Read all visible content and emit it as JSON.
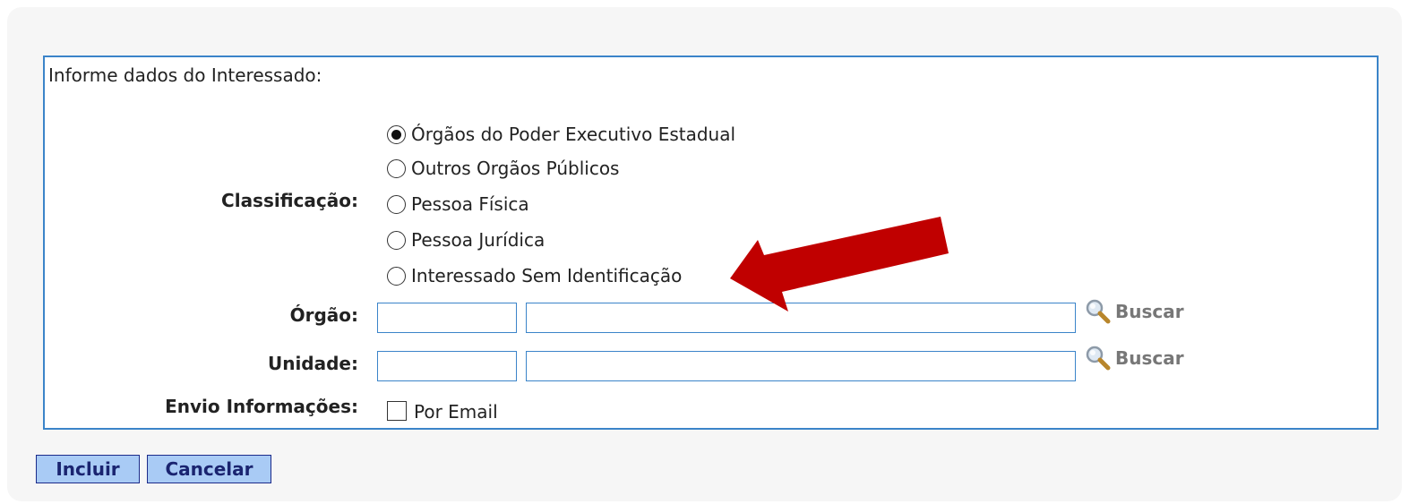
{
  "form": {
    "title": "Informe dados do Interessado:",
    "classificacao_label": "Classificação:",
    "classificacao_options": [
      {
        "label": "Órgãos do Poder Executivo Estadual",
        "checked": true
      },
      {
        "label": "Outros Orgãos Públicos",
        "checked": false
      },
      {
        "label": "Pessoa Física",
        "checked": false
      },
      {
        "label": "Pessoa Jurídica",
        "checked": false
      },
      {
        "label": "Interessado Sem Identificação",
        "checked": false
      }
    ],
    "orgao_label": "Órgão:",
    "orgao_code_value": "",
    "orgao_name_value": "",
    "unidade_label": "Unidade:",
    "unidade_code_value": "",
    "unidade_name_value": "",
    "buscar_label": "Buscar",
    "envio_label": "Envio Informações:",
    "por_email_label": "Por Email",
    "por_email_checked": false
  },
  "actions": {
    "incluir": "Incluir",
    "cancelar": "Cancelar"
  },
  "annotation": {
    "arrow_color": "#c00000",
    "arrow_icon": "red-arrow-icon"
  },
  "colors": {
    "panel_border": "#3b84c9",
    "button_bg": "#a9cbf5",
    "button_border": "#1c2b8a"
  }
}
